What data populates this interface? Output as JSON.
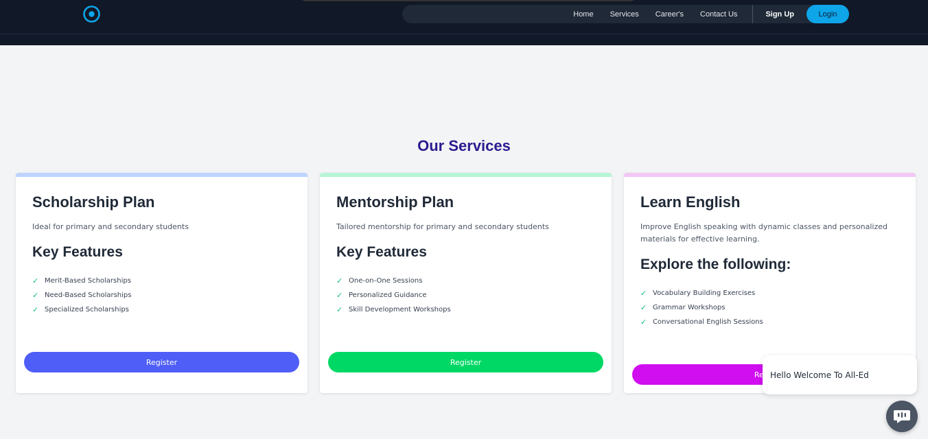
{
  "nav": {
    "links": [
      "Home",
      "Services",
      "Career's",
      "Contact Us"
    ],
    "signup": "Sign Up",
    "login": "Login"
  },
  "section_title": "Our Services",
  "cards": [
    {
      "title": "Scholarship Plan",
      "description": "Ideal for primary and secondary students",
      "subheading": "Key Features",
      "features": [
        "Merit-Based Scholarships",
        "Need-Based Scholarships",
        "Specialized Scholarships"
      ],
      "button": "Register",
      "accent_color": "#bfd3ff",
      "button_color": "#4f5ef7"
    },
    {
      "title": "Mentorship Plan",
      "description": "Tailored mentorship for primary and secondary students",
      "subheading": "Key Features",
      "features": [
        "One-on-One Sessions",
        "Personalized Guidance",
        "Skill Development Workshops"
      ],
      "button": "Register",
      "accent_color": "#b6f5d6",
      "button_color": "#00d865"
    },
    {
      "title": "Learn English",
      "description": "Improve English speaking with dynamic classes and personalized materials for effective learning.",
      "subheading": "Explore the following:",
      "features": [
        "Vocabulary Building Exercises",
        "Grammar Workshops",
        "Conversational English Sessions"
      ],
      "button": "Register",
      "accent_color": "#f3c8f5",
      "button_color": "#d10ef0"
    }
  ],
  "chat": {
    "message": "Hello Welcome To All-Ed",
    "icon": "chat-icon"
  },
  "colors": {
    "header_bg": "#111827",
    "login_bg": "#0ea5e9",
    "title_color": "#2a1b8f",
    "page_bg": "#f3f4f6"
  }
}
